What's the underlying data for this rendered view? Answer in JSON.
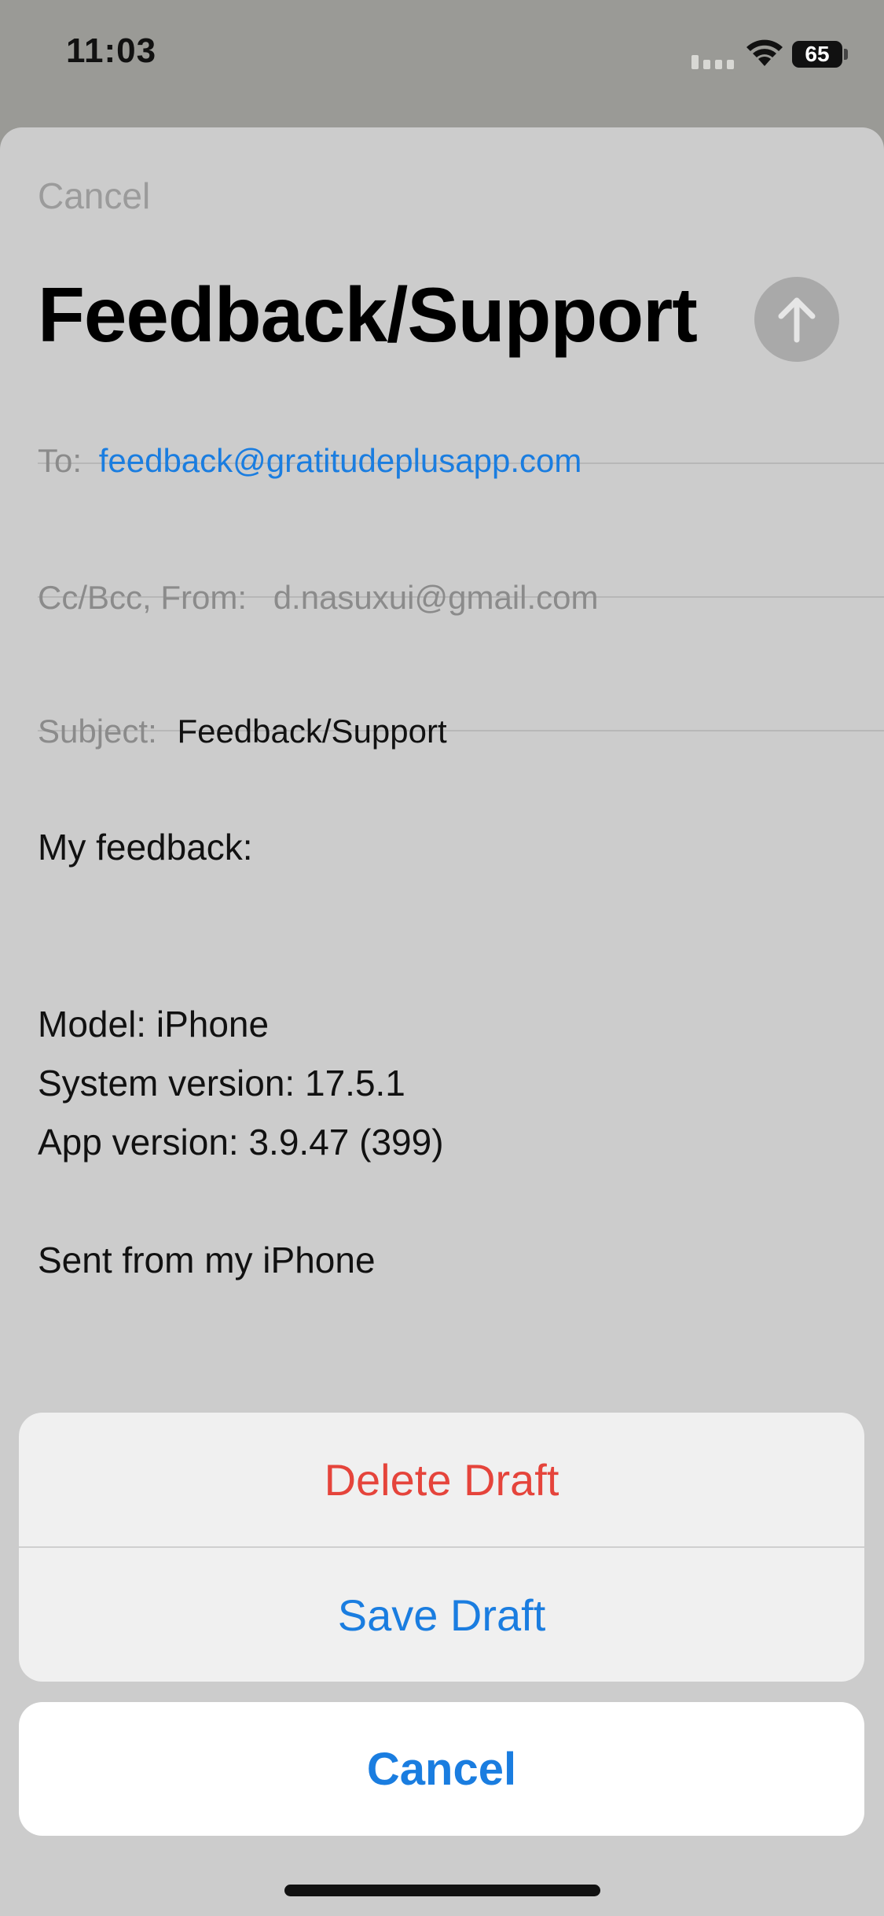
{
  "status": {
    "time": "11:03",
    "battery": "65"
  },
  "mail": {
    "cancel_label": "Cancel",
    "title": "Feedback/Support",
    "to_label": "To:",
    "to_value": "feedback@gratitudeplusapp.com",
    "cc_label": "Cc/Bcc, From:",
    "cc_value": "d.nasuxui@gmail.com",
    "subject_label": "Subject:",
    "subject_value": "Feedback/Support",
    "body": "My feedback:\n\n\nModel: iPhone\nSystem version: 17.5.1\nApp version: 3.9.47 (399)\n\nSent from my iPhone"
  },
  "action_sheet": {
    "delete_label": "Delete Draft",
    "save_label": "Save Draft",
    "cancel_label": "Cancel"
  },
  "colors": {
    "link_blue": "#1a7de0",
    "destructive_red": "#e5443b",
    "label_gray": "#8b8b8b"
  },
  "icons": {
    "send": "arrow-up-icon",
    "wifi": "wifi-icon",
    "battery": "battery-icon",
    "signal": "cellular-signal-icon"
  }
}
